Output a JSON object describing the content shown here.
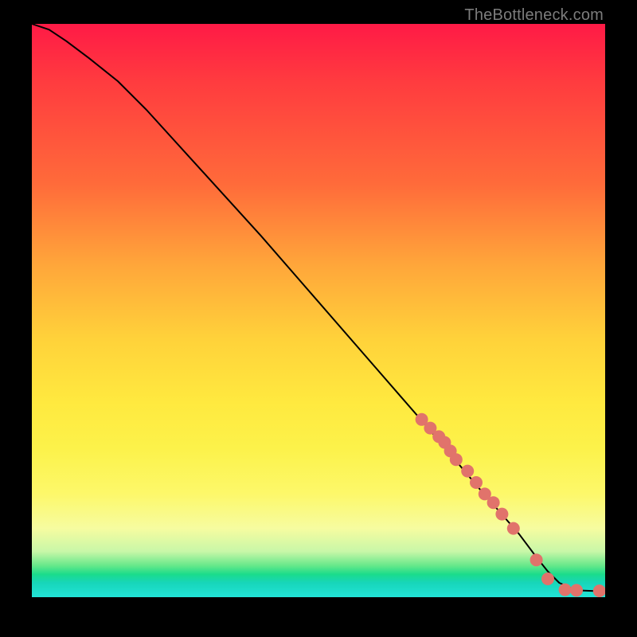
{
  "attribution": "TheBottleneck.com",
  "chart_data": {
    "type": "line",
    "title": "",
    "xlabel": "",
    "ylabel": "",
    "xlim": [
      0,
      100
    ],
    "ylim": [
      0,
      100
    ],
    "grid": false,
    "series": [
      {
        "name": "curve",
        "style": "line",
        "color": "#000000",
        "x": [
          0,
          3,
          6,
          10,
          15,
          20,
          30,
          40,
          50,
          60,
          70,
          78,
          85,
          88,
          90,
          92,
          95,
          100
        ],
        "y": [
          100,
          99,
          97,
          94,
          90,
          85,
          74,
          63,
          51.5,
          40,
          28.5,
          19,
          11,
          7,
          4.5,
          2.5,
          1.2,
          1.0
        ]
      },
      {
        "name": "highlighted-points",
        "style": "scatter",
        "color": "#e1736b",
        "x": [
          68,
          69.5,
          71,
          72,
          73,
          74,
          76,
          77.5,
          79,
          80.5,
          82,
          84,
          88,
          90,
          93,
          95,
          99
        ],
        "y": [
          31,
          29.5,
          28,
          27,
          25.5,
          24,
          22,
          20,
          18,
          16.5,
          14.5,
          12,
          6.5,
          3.2,
          1.3,
          1.2,
          1.1
        ]
      }
    ]
  }
}
